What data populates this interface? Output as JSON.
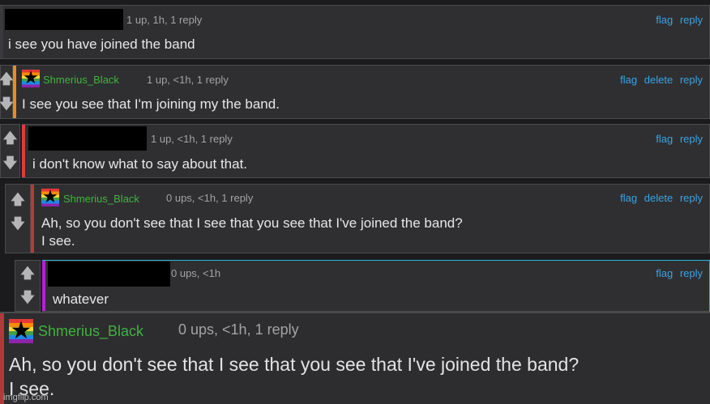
{
  "comments": [
    {
      "username": "",
      "meta": "1 up, 1h, 1 reply",
      "actions": [
        "flag",
        "reply"
      ],
      "body": [
        "i see you have joined the band"
      ],
      "stripe_color": "#3a3a3d",
      "redacted_name": true
    },
    {
      "username": "Shmerius_Black",
      "meta": "1 up, <1h, 1 reply",
      "actions": [
        "flag",
        "delete",
        "reply"
      ],
      "body": [
        "I see you see that I'm joining my the band."
      ],
      "stripe_color": "#f08a1c"
    },
    {
      "username": "",
      "meta": "1 up, <1h, 1 reply",
      "actions": [
        "flag",
        "reply"
      ],
      "body": [
        "i don't know what to say about that."
      ],
      "stripe_color": "#e23a3a",
      "redacted_name": true
    },
    {
      "username": "Shmerius_Black",
      "meta": "0 ups, <1h, 1 reply",
      "actions": [
        "flag",
        "delete",
        "reply"
      ],
      "body": [
        "Ah, so you don't see that I see that you see that I've joined the band?",
        "I see."
      ],
      "stripe_color": "#b63a3a"
    },
    {
      "username": "",
      "meta": "0 ups, <1h",
      "actions": [
        "flag",
        "reply"
      ],
      "body": [
        "whatever"
      ],
      "stripe_color": "#b51fd6",
      "redacted_name": true
    }
  ],
  "zoomed": {
    "username": "Shmerius_Black",
    "meta": "0 ups, <1h, 1 reply",
    "body": [
      "Ah, so you don't see that I see that you see that I've joined the band?",
      "I see."
    ],
    "stripe_color": "#b03a3a"
  },
  "icons": {
    "upvote": "up-arrow-icon",
    "downvote": "down-arrow-icon",
    "avatar": "rainbow-star-avatar"
  },
  "colors": {
    "username": "#3fb33f",
    "link": "#3aa3e3",
    "meta": "#a3a3a6",
    "background": "#2f2f31"
  },
  "watermark": "imgflip.com"
}
